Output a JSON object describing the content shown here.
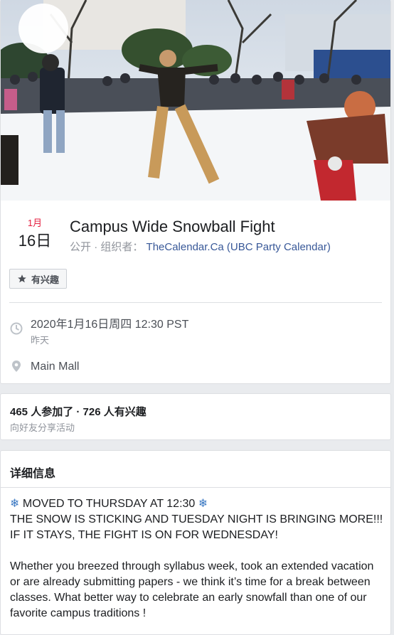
{
  "event": {
    "month": "1月",
    "day": "16日",
    "title": "Campus Wide Snowball Fight",
    "privacy": "公开",
    "organizer_prefix": "· 组织者：",
    "organizer": "TheCalendar.Ca (UBC Party Calendar)",
    "interested_button": "有兴趣",
    "datetime": "2020年1月16日周四 12:30 PST",
    "relative": "昨天",
    "location": "Main Mall"
  },
  "stats": {
    "summary": "465 人参加了 · 726 人有兴趣",
    "share": "向好友分享活动"
  },
  "details": {
    "heading": "详细信息",
    "line1": "MOVED TO THURSDAY AT 12:30",
    "line2": "THE SNOW IS STICKING AND TUESDAY NIGHT IS BRINGING MORE!!! IF IT STAYS, THE FIGHT IS ON FOR WEDNESDAY!",
    "line3": "Whether you breezed through syllabus week, took an extended vacation or are already submitting papers - we think it’s time for a break between classes. What better way to celebrate an early snowfall than one of our favorite campus traditions !"
  },
  "icons": {
    "star": "star-icon",
    "clock": "clock-icon",
    "pin": "location-pin-icon",
    "snowflake": "snowflake-icon"
  },
  "colors": {
    "link": "#385898",
    "month": "#e41e3f"
  }
}
